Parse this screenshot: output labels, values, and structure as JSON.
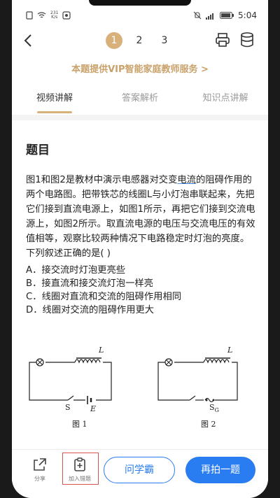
{
  "status": {
    "speed_top": "231",
    "speed_bottom": "K/s",
    "battery": "5:04"
  },
  "nav": {
    "pages": [
      "1",
      "2",
      "3"
    ],
    "active_page": "1"
  },
  "vip_banner": "本题提供VIP智能家庭教师服务 >",
  "tabs": [
    "视频讲解",
    "答案解析",
    "知识点讲解"
  ],
  "question": {
    "heading": "题目",
    "text_part1": "图1和图2是教材中演示电感器对交变",
    "text_underlined": "电流",
    "text_part2": "的阻碍作用的两个电路图。把带铁芯的线圈L与小灯泡串联起来，先把它们接到直流电源上，如图1所示，再把它们接到交流电源上，如图2所示。取直流电源的电压与交流电压的有效值相等，观察比较两种情况下电路稳定时灯泡的亮度。下列叙述正确的是(  )",
    "options": [
      "A．接交流时灯泡更亮些",
      "B．接直流和接交流灯泡一样亮",
      "C．线圈对直流和交流的阻碍作用相同",
      "D．线圈对交流的阻碍作用更大"
    ]
  },
  "diagrams": {
    "fig1_label": "图 1",
    "fig2_label": "图 2",
    "inductor_label": "L",
    "switch_label": "S",
    "emf_label": "E",
    "ac_label": "S",
    "ac_sub": "G"
  },
  "bottom": {
    "share_label": "分享",
    "join_label": "加入错题",
    "classmate_button": "问学霸",
    "retake_button": "再拍一题"
  },
  "colors": {
    "accent_gold": "#d8b07a",
    "vip_text": "#c9a16a",
    "primary_blue": "#2a7df0"
  }
}
